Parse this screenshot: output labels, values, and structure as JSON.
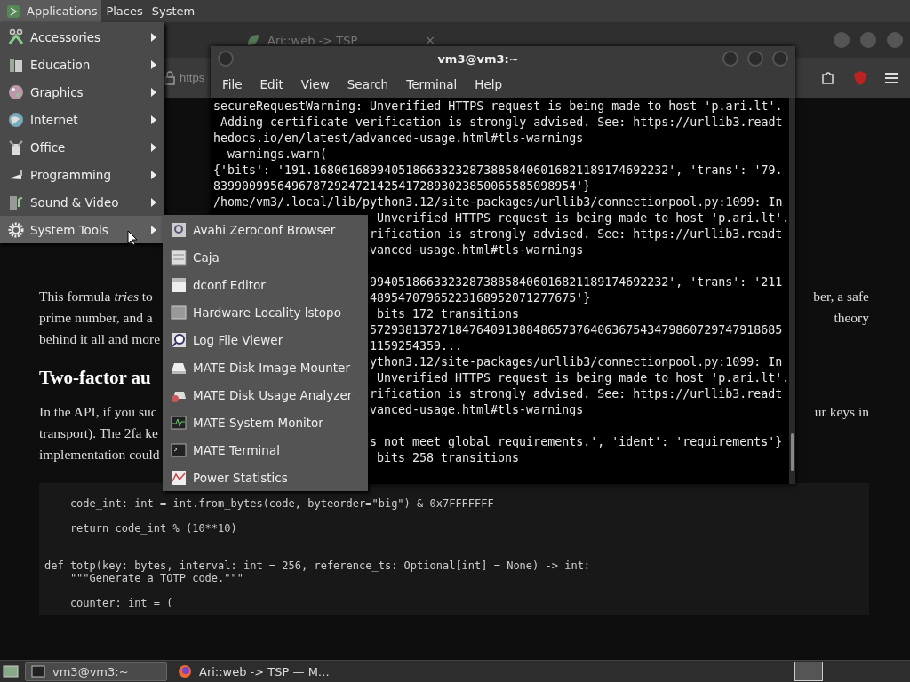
{
  "top_panel": {
    "menus": [
      {
        "label": "Applications",
        "selected": true
      },
      {
        "label": "Places",
        "selected": false
      },
      {
        "label": "System",
        "selected": false
      }
    ]
  },
  "browser": {
    "tab": {
      "title": "Ari::web -> TSP",
      "close": "×"
    },
    "address": "https",
    "page": {
      "paragraph_1": [
        {
          "left": "This formula *tries* to",
          "right": "ber, a safe"
        },
        {
          "left": "prime number, and a",
          "right": "theory"
        },
        {
          "left": "behind it all and more"
        }
      ],
      "heading": "Two-factor au",
      "paragraph_2": [
        {
          "left": "In the API, if you suc",
          "right": "ur keys in"
        },
        {
          "left": "transport). The 2fa ke"
        },
        {
          "left": "implementation could"
        }
      ],
      "code": [
        {
          "kind": "text",
          "text": "    code_int: int = int.from_bytes(code, byteorder=\"big\") & 0x7FFFFFFF"
        },
        {
          "kind": "blank"
        },
        {
          "kind": "text",
          "text": "    return code_int % (10**10)"
        },
        {
          "kind": "blank"
        },
        {
          "kind": "blank"
        },
        {
          "kind": "text",
          "text": "def totp(key: bytes, interval: int = 256, reference_ts: Optional[int] = None) -> int:"
        },
        {
          "kind": "text",
          "text": "    \"\"\"Generate a TOTP code.\"\"\""
        },
        {
          "kind": "blank"
        },
        {
          "kind": "text",
          "text": "    counter: int = ("
        }
      ]
    }
  },
  "terminal": {
    "title": "vm3@vm3:~",
    "menu": [
      "File",
      "Edit",
      "View",
      "Search",
      "Terminal",
      "Help"
    ],
    "lines": [
      {
        "kind": "full",
        "text": "secureRequestWarning: Unverified HTTPS request is being made to host 'p.ari.lt'."
      },
      {
        "kind": "full",
        "text": " Adding certificate verification is strongly advised. See: https://urllib3.readt"
      },
      {
        "kind": "full",
        "text": "hedocs.io/en/latest/advanced-usage.html#tls-warnings"
      },
      {
        "kind": "full",
        "text": "  warnings.warn("
      },
      {
        "kind": "full",
        "text": "{'bits': '191.16806168994051866332328738858406016821189174692232', 'trans': '79."
      },
      {
        "kind": "full",
        "text": "839900995649678729247214254172893023850065585098954'}"
      },
      {
        "kind": "full",
        "text": "/home/vm3/.local/lib/python3.12/site-packages/urllib3/connectionpool.py:1099: In"
      },
      {
        "kind": "partial",
        "text": " Unverified HTTPS request is being made to host 'p.ari.lt'."
      },
      {
        "kind": "partial",
        "text": "rification is strongly advised. See: https://urllib3.readt"
      },
      {
        "kind": "partial",
        "text": "vanced-usage.html#tls-warnings"
      },
      {
        "kind": "blank"
      },
      {
        "kind": "partial",
        "text": "994051866332328738858406016821189174692232', 'trans': '211"
      },
      {
        "kind": "partial",
        "text": "48954707965223168952071277675'}"
      },
      {
        "kind": "partial",
        "text": " bits 172 transitions"
      },
      {
        "kind": "partial",
        "text": "5729381372718476409138848657376406367543479860729747918685"
      },
      {
        "kind": "partial",
        "text": "1159254359..."
      },
      {
        "kind": "partial",
        "text": "ython3.12/site-packages/urllib3/connectionpool.py:1099: In"
      },
      {
        "kind": "partial",
        "text": " Unverified HTTPS request is being made to host 'p.ari.lt'."
      },
      {
        "kind": "partial",
        "text": "rification is strongly advised. See: https://urllib3.readt"
      },
      {
        "kind": "partial",
        "text": "vanced-usage.html#tls-warnings"
      },
      {
        "kind": "blank"
      },
      {
        "kind": "partial",
        "text": "s not meet global requirements.', 'ident': 'requirements'}"
      },
      {
        "kind": "partial",
        "text": " bits 258 transitions"
      }
    ]
  },
  "applications_menu": {
    "items": [
      {
        "label": "Accessories",
        "selected": false
      },
      {
        "label": "Education",
        "selected": false
      },
      {
        "label": "Graphics",
        "selected": false
      },
      {
        "label": "Internet",
        "selected": false
      },
      {
        "label": "Office",
        "selected": false
      },
      {
        "label": "Programming",
        "selected": false
      },
      {
        "label": "Sound & Video",
        "selected": false
      },
      {
        "label": "System Tools",
        "selected": true
      }
    ]
  },
  "system_tools_menu": {
    "items": [
      {
        "label": "Avahi Zeroconf Browser"
      },
      {
        "label": "Caja"
      },
      {
        "label": "dconf Editor"
      },
      {
        "label": "Hardware Locality lstopo"
      },
      {
        "label": "Log File Viewer"
      },
      {
        "label": "MATE Disk Image Mounter"
      },
      {
        "label": "MATE Disk Usage Analyzer"
      },
      {
        "label": "MATE System Monitor"
      },
      {
        "label": "MATE Terminal"
      },
      {
        "label": "Power Statistics"
      }
    ]
  },
  "taskbar": {
    "tasks": [
      {
        "label": "vm3@vm3:~",
        "selected": true
      },
      {
        "label": "Ari::web -> TSP — M…",
        "selected": false
      }
    ]
  }
}
